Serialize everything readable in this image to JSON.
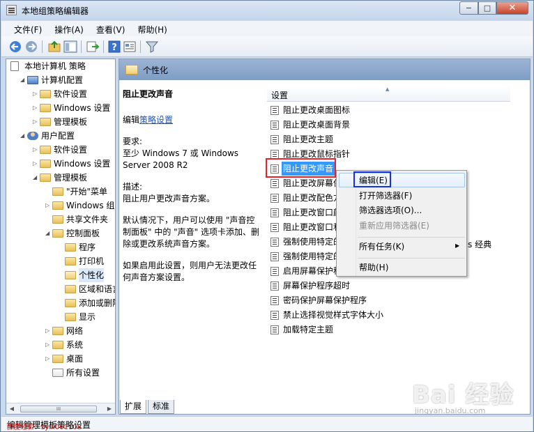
{
  "window": {
    "title": "本地组策略编辑器",
    "min_glyph": "−",
    "max_glyph": "□",
    "close_glyph": "✕"
  },
  "menu": [
    "文件(F)",
    "操作(A)",
    "查看(V)",
    "帮助(H)"
  ],
  "tree": {
    "items": [
      {
        "label": "本地计算机 策略",
        "level": 0,
        "exp": "",
        "icon": "policy"
      },
      {
        "label": "计算机配置",
        "level": 1,
        "exp": "◢",
        "icon": "computer"
      },
      {
        "label": "软件设置",
        "level": 2,
        "exp": "▷",
        "icon": "folder"
      },
      {
        "label": "Windows 设置",
        "level": 2,
        "exp": "▷",
        "icon": "folder"
      },
      {
        "label": "管理模板",
        "level": 2,
        "exp": "▷",
        "icon": "folder"
      },
      {
        "label": "用户配置",
        "level": 1,
        "exp": "◢",
        "icon": "user"
      },
      {
        "label": "软件设置",
        "level": 2,
        "exp": "▷",
        "icon": "folder"
      },
      {
        "label": "Windows 设置",
        "level": 2,
        "exp": "▷",
        "icon": "folder"
      },
      {
        "label": "管理模板",
        "level": 2,
        "exp": "◢",
        "icon": "folder"
      },
      {
        "label": "\"开始\"菜单",
        "level": 3,
        "exp": "",
        "icon": "folder"
      },
      {
        "label": "Windows 组件",
        "level": 3,
        "exp": "▷",
        "icon": "folder"
      },
      {
        "label": "共享文件夹",
        "level": 3,
        "exp": "",
        "icon": "folder"
      },
      {
        "label": "控制面板",
        "level": 3,
        "exp": "◢",
        "icon": "folder"
      },
      {
        "label": "程序",
        "level": 4,
        "exp": "",
        "icon": "folder"
      },
      {
        "label": "打印机",
        "level": 4,
        "exp": "",
        "icon": "folder"
      },
      {
        "label": "个性化",
        "level": 4,
        "exp": "",
        "icon": "folder-open",
        "selected": true
      },
      {
        "label": "区域和语言",
        "level": 4,
        "exp": "",
        "icon": "folder"
      },
      {
        "label": "添加或删除",
        "level": 4,
        "exp": "",
        "icon": "folder"
      },
      {
        "label": "显示",
        "level": 4,
        "exp": "",
        "icon": "folder"
      },
      {
        "label": "网络",
        "level": 3,
        "exp": "▷",
        "icon": "folder"
      },
      {
        "label": "系统",
        "level": 3,
        "exp": "▷",
        "icon": "folder"
      },
      {
        "label": "桌面",
        "level": 3,
        "exp": "▷",
        "icon": "folder"
      },
      {
        "label": "所有设置",
        "level": 3,
        "exp": "",
        "icon": "settings"
      }
    ],
    "scroll_left": "◀",
    "scroll_right": "▶",
    "scroll_thumb": "III"
  },
  "header": {
    "title": "个性化"
  },
  "description": {
    "heading": "阻止更改声音",
    "edit_prefix": "编辑",
    "edit_link": "策略设置",
    "req_label": "要求:",
    "req_text": "至少 Windows 7 或 Windows Server 2008 R2",
    "desc_label": "描述:",
    "desc_text": "阻止用户更改声音方案。",
    "body1": "默认情况下，用户可以使用 \"声音控制面板\" 中的 \"声音\" 选项卡添加、删除或更改系统声音方案。",
    "body2": "如果启用此设置，则用户无法更改任何声音方案设置。"
  },
  "list": {
    "header": "设置",
    "sort_glyph": "▲",
    "items": [
      "阻止更改桌面图标",
      "阻止更改桌面背景",
      "阻止更改主题",
      "阻止更改鼠标指针",
      "阻止更改声音",
      "阻止更改屏幕保",
      "阻止更改配色方",
      "阻止更改窗口颜",
      "阻止更改窗口和",
      "强制使用特定的",
      "强制使用特定的",
      "启用屏幕保护程",
      "屏幕保护程序超时",
      "密码保护屏幕保护程序",
      "禁止选择视觉样式字体大小",
      "加载特定主题"
    ],
    "selected_index": 4,
    "tail_text": "s 经典"
  },
  "context_menu": {
    "items": [
      {
        "label": "编辑(E)",
        "disabled": false
      },
      {
        "label": "打开筛选器(F)",
        "disabled": false
      },
      {
        "label": "筛选器选项(O)...",
        "disabled": false
      },
      {
        "label": "重新应用筛选器(E)",
        "disabled": true
      },
      {
        "label": "所有任务(K)",
        "disabled": false,
        "submenu": true
      },
      {
        "label": "帮助(H)",
        "disabled": false
      }
    ],
    "submenu_glyph": "▶"
  },
  "tabs": [
    "扩展",
    "标准"
  ],
  "status": {
    "text": "编辑管理模板策略设置",
    "watermark": "百度经验：zylx001108"
  },
  "branding": {
    "baidu": "Bai 经验",
    "url": "jingyan.baidu.com"
  },
  "colors": {
    "accent": "#3399ff",
    "red_highlight": "#e8202a",
    "blue_highlight": "#1a2fd8"
  }
}
